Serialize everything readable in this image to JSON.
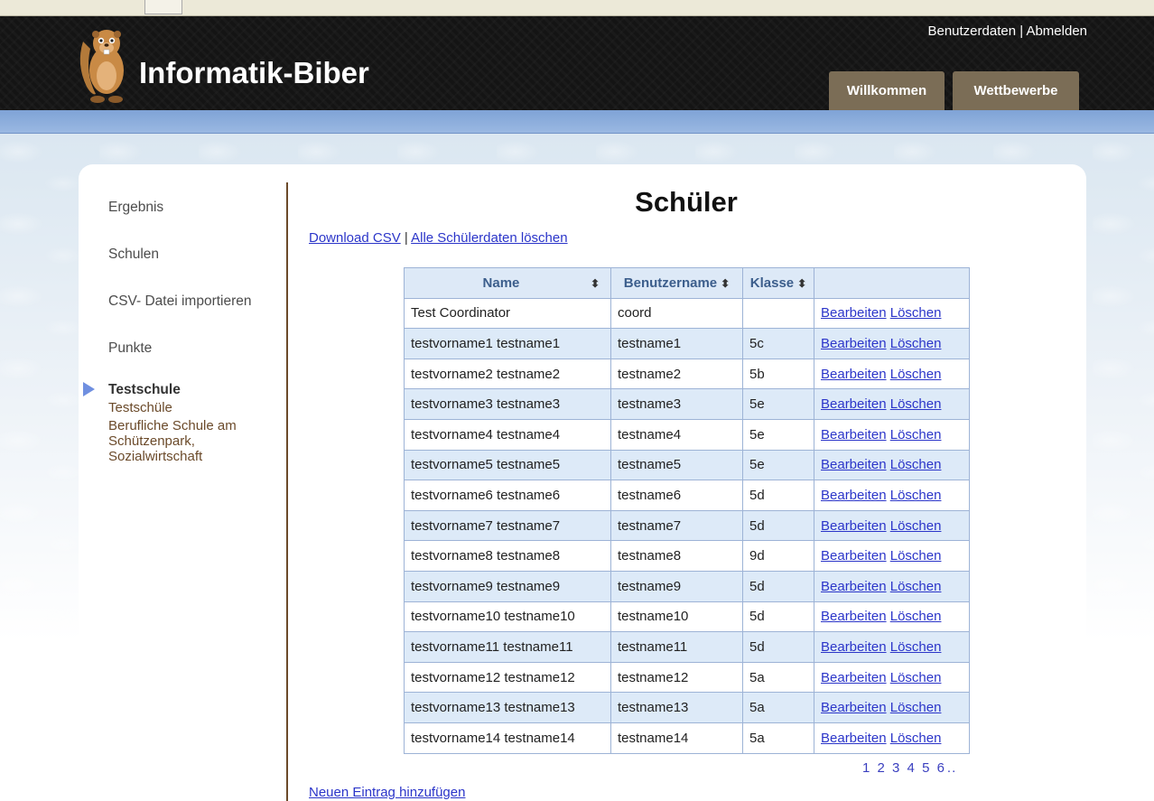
{
  "header": {
    "site_title": "Informatik-Biber",
    "user_links": {
      "profile": "Benutzerdaten",
      "separator": " | ",
      "logout": "Abmelden"
    },
    "tabs": [
      {
        "label": "Willkommen"
      },
      {
        "label": "Wettbewerbe"
      }
    ]
  },
  "sidebar": {
    "items": [
      {
        "label": "Ergebnis"
      },
      {
        "label": "Schulen"
      },
      {
        "label": "CSV- Datei importieren"
      },
      {
        "label": "Punkte"
      }
    ],
    "active": "Testschule",
    "sub_items": [
      {
        "label": "Testschüle"
      },
      {
        "label": "Berufliche Schule am Schützenpark, Sozialwirtschaft"
      }
    ]
  },
  "main": {
    "title": "Schüler",
    "actions": {
      "download": "Download CSV",
      "separator": " | ",
      "delete_all": "Alle Schülerdaten löschen"
    },
    "table": {
      "headers": {
        "name": "Name",
        "username": "Benutzername",
        "klasse": "Klasse",
        "actions": ""
      },
      "sort_icon": "⬍",
      "edit_label": "Bearbeiten",
      "delete_label": "Löschen",
      "rows": [
        {
          "name": "Test Coordinator",
          "username": "coord",
          "klasse": ""
        },
        {
          "name": "testvorname1 testname1",
          "username": "testname1",
          "klasse": "5c"
        },
        {
          "name": "testvorname2 testname2",
          "username": "testname2",
          "klasse": "5b"
        },
        {
          "name": "testvorname3 testname3",
          "username": "testname3",
          "klasse": "5e"
        },
        {
          "name": "testvorname4 testname4",
          "username": "testname4",
          "klasse": "5e"
        },
        {
          "name": "testvorname5 testname5",
          "username": "testname5",
          "klasse": "5e"
        },
        {
          "name": "testvorname6 testname6",
          "username": "testname6",
          "klasse": "5d"
        },
        {
          "name": "testvorname7 testname7",
          "username": "testname7",
          "klasse": "5d"
        },
        {
          "name": "testvorname8 testname8",
          "username": "testname8",
          "klasse": "9d"
        },
        {
          "name": "testvorname9 testname9",
          "username": "testname9",
          "klasse": "5d"
        },
        {
          "name": "testvorname10 testname10",
          "username": "testname10",
          "klasse": "5d"
        },
        {
          "name": "testvorname11 testname11",
          "username": "testname11",
          "klasse": "5d"
        },
        {
          "name": "testvorname12 testname12",
          "username": "testname12",
          "klasse": "5a"
        },
        {
          "name": "testvorname13 testname13",
          "username": "testname13",
          "klasse": "5a"
        },
        {
          "name": "testvorname14 testname14",
          "username": "testname14",
          "klasse": "5a"
        }
      ]
    },
    "pagination": {
      "pages": [
        "1",
        "2",
        "3",
        "4",
        "5",
        "6"
      ],
      "more": ".."
    },
    "new_entry": "Neuen Eintrag hinzufügen"
  },
  "colors": {
    "header_bg": "#141414",
    "tab_bg": "#7b6d56",
    "band_blue": "#8caedd",
    "link": "#2b35c9",
    "table_header_bg": "#dde9f7",
    "row_alt_bg": "#ddeaf8",
    "sidebar_divider": "#6b4a2a"
  }
}
